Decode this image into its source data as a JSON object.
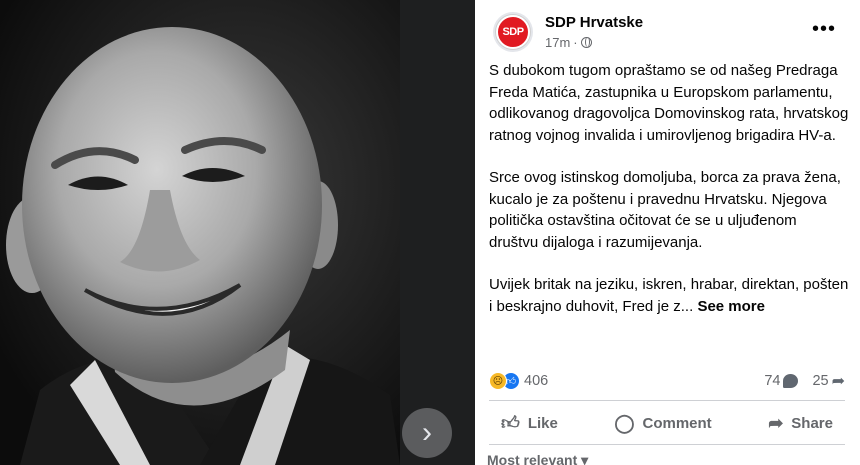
{
  "post": {
    "page_name": "SDP Hrvatske",
    "avatar_text": "SDP",
    "time": "17m",
    "paragraphs": [
      "S dubokom tugom opraštamo se od našeg Predraga Freda Matića, zastupnika u Europskom parlamentu, odlikovanog dragovoljca Domovinskog rata, hrvatskog ratnog vojnog invalida i umirovljenog brigadira HV-a.",
      "Srce ovog istinskog domoljuba, borca za prava žena, kucalo je za poštenu i pravednu Hrvatsku. Njegova politička ostavština očitovat će se u uljuđenom društvu dijaloga i razumijevanja.",
      "Uvijek britak na jeziku, iskren, hrabar, direktan, pošten i beskrajno duhovit, Fred je z..."
    ],
    "see_more": "See more"
  },
  "stats": {
    "reactions": "406",
    "comments": "74",
    "shares": "25"
  },
  "actions": {
    "like": "Like",
    "comment": "Comment",
    "share": "Share"
  },
  "comments_filter": "Most relevant",
  "icons": {
    "next": "chevron-right-icon",
    "more": "more-options-icon",
    "privacy": "globe-icon"
  },
  "colors": {
    "brand_red": "#e11a22",
    "like_blue": "#1877f2",
    "sad_yellow": "#f7b928"
  }
}
